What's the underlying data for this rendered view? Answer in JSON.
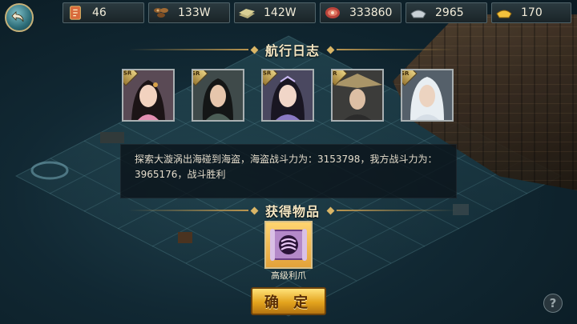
{
  "top_bar": {
    "resources": [
      {
        "icon": "token-icon",
        "value": "46"
      },
      {
        "icon": "wood-icon",
        "value": "133W"
      },
      {
        "icon": "grain-icon",
        "value": "142W"
      },
      {
        "icon": "meat-icon",
        "value": "333860"
      },
      {
        "icon": "silver-icon",
        "value": "2965"
      },
      {
        "icon": "gold-icon",
        "value": "170"
      }
    ]
  },
  "log": {
    "title": "航行日志",
    "heroes": [
      {
        "badge": "SSR",
        "icon": "hero-female-pink-portrait"
      },
      {
        "badge": "SR",
        "icon": "hero-swordsman-portrait"
      },
      {
        "badge": "SSR",
        "icon": "hero-female-purple-portrait"
      },
      {
        "badge": "R",
        "icon": "hero-straw-hat-portrait"
      },
      {
        "badge": "SR",
        "icon": "hero-white-hair-portrait"
      }
    ],
    "message": "探索大漩涡出海碰到海盗，海盗战斗力为：3153798，我方战斗力为：3965176，战斗胜利"
  },
  "rewards": {
    "title": "获得物品",
    "item_name": "高级利爪",
    "item_icon": "claw-scroll-icon"
  },
  "actions": {
    "confirm": "确 定",
    "help": "?"
  }
}
